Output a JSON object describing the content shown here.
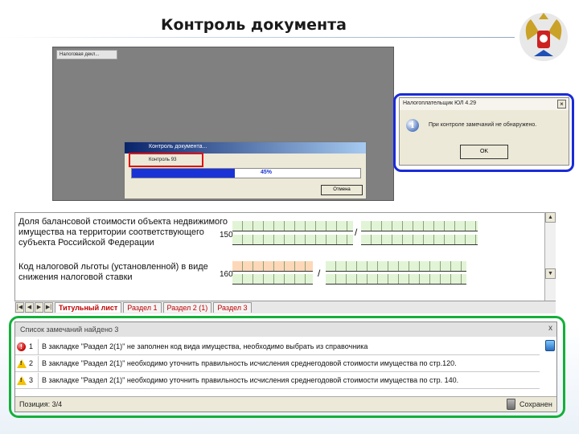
{
  "slide": {
    "title": "Контроль документа"
  },
  "emblem": {
    "icon": "russian-coat-of-arms-icon"
  },
  "app_window": {
    "title": "Налоговая декл..."
  },
  "progress_dialog": {
    "title": "Контроль документа...",
    "status": "Контроль 93",
    "progress_percent": 45,
    "progress_label": "45%",
    "cancel_label": "Отмена"
  },
  "info_dialog": {
    "title": "Налогоплательщик ЮЛ 4.29",
    "icon": "info-icon",
    "message": "При контроле замечаний не обнаружено.",
    "ok_label": "OK"
  },
  "form": {
    "row1_label": "Доля балансовой стоимости объекта недвижимого имущества на территории соответствующего субъекта Российской Федерации",
    "row1_code": "150",
    "row2_label": "Код налоговой льготы (установленной) в виде снижения налоговой ставки",
    "row2_code": "160",
    "slash": "/"
  },
  "tabs": [
    {
      "label": "Титульный лист",
      "active": true
    },
    {
      "label": "Раздел 1",
      "active": false
    },
    {
      "label": "Раздел 2 (1)",
      "active": false
    },
    {
      "label": "Раздел 3",
      "active": false
    }
  ],
  "errors": {
    "header": "Список замечаний найдено 3",
    "close": "x",
    "rows": [
      {
        "num": "1",
        "type": "error",
        "text": "В закладке \"Раздел 2(1)\" не заполнен код вида имущества, необходимо выбрать из справочника"
      },
      {
        "num": "2",
        "type": "warning",
        "text": "В закладке \"Раздел 2(1)\" необходимо уточнить правильность исчисления среднегодовой стоимости имущества по стр.120."
      },
      {
        "num": "3",
        "type": "warning",
        "text": "В закладке \"Раздел 2(1)\" необходимо уточнить правильность исчисления среднегодовой стоимости имущества по стр. 140."
      }
    ],
    "status_position": "Позиция: 3/4",
    "status_state": "Сохранен"
  },
  "colors": {
    "highlight_red": "#e01010",
    "highlight_blue": "#1a2bd8",
    "highlight_green": "#14b03a",
    "progress": "#1a33d6"
  }
}
